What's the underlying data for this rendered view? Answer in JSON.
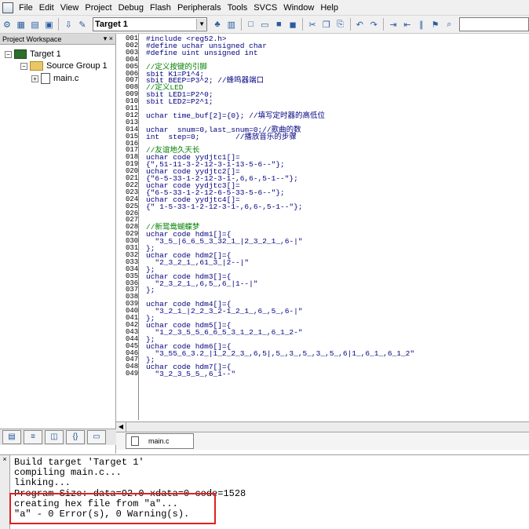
{
  "menubar": {
    "items": [
      "File",
      "Edit",
      "View",
      "Project",
      "Debug",
      "Flash",
      "Peripherals",
      "Tools",
      "SVCS",
      "Window",
      "Help"
    ]
  },
  "toolbar": {
    "target": "Target 1"
  },
  "workspace": {
    "title": "Project Workspace",
    "close": "▾ ×",
    "tree": {
      "target": "Target 1",
      "group": "Source Group 1",
      "file": "main.c"
    }
  },
  "editor": {
    "line_numbers": [
      "001",
      "002",
      "003",
      "004",
      "005",
      "006",
      "007",
      "008",
      "009",
      "010",
      "011",
      "012",
      "013",
      "014",
      "015",
      "016",
      "017",
      "018",
      "019",
      "020",
      "021",
      "022",
      "023",
      "024",
      "025",
      "026",
      "027",
      "028",
      "029",
      "030",
      "031",
      "032",
      "033",
      "034",
      "035",
      "036",
      "037",
      "038",
      "039",
      "040",
      "041",
      "042",
      "043",
      "044",
      "045",
      "046",
      "047",
      "048",
      "049"
    ],
    "lines": [
      "#include <reg52.h>",
      "#define uchar unsigned char",
      "#define uint unsigned int",
      "",
      "//定义按键的引脚",
      "sbit K1=P1^4;",
      "sbit BEEP=P3^2; //蜂鸣器端口",
      "//定义LED",
      "sbit LED1=P2^0;",
      "sbit LED2=P2^1;",
      "",
      "uchar time_buf[2]={0}; //填写定时器的高低位",
      "",
      "uchar  snum=0,last_snum=0;//歌曲的数",
      "int  step=0;        //播放音乐的步骤",
      "",
      "//友谊地久天长",
      "uchar code yydjtc1[]=",
      "{\",51-11-3-2-12-3-1-13-5-6--\"};",
      "uchar code yydjtc2[]=",
      "{\"6-5-33-1-2-12-3-1-,6,6-,5-1--\"};",
      "uchar code yydjtc3[]=",
      "{\"6-5-33-1-2-12-6-5-33-5-6--\"};",
      "uchar code yydjtc4[]=",
      "{\" 1-5-33-1-2-12-3-1-,6,6-,5-1--\"};",
      "",
      "",
      "//新鸳鸯蝴蝶梦",
      "uchar code hdm1[]={",
      "  \"3_5_|6_6_5_3_32_1_|2_3_2_1_,6-|\"",
      "};",
      "uchar code hdm2[]={",
      "  \"2_3_2_1_,61_3_|2--|\"",
      "};",
      "uchar code hdm3[]={",
      "  \"2_3_2_1_,6,5_,6_|1--|\"",
      "};",
      "",
      "uchar code hdm4[]={",
      "  \"3_2_1_|2_2_3_2-1_2_1_,6_,5_,6-|\"",
      "};",
      "uchar code hdm5[]={",
      "  \"1_2_3_5_5_6_6_5_3_1_2_1_,6_1_2-\"",
      "};",
      "uchar code hdm6[]={",
      "  \"3_55_6_3.2_|1_2_2_3_,6,5|,5_,3_,5_,3_,5_,6|1_,6_1_,6_1_2\"",
      "};",
      "uchar code hdm7[]={",
      "  \"3_2_3_5_5_,6_1--\""
    ]
  },
  "doc_tab": "main.c",
  "output": {
    "lines": [
      "Build target 'Target 1'",
      "compiling main.c...",
      "linking...",
      "Program Size: data=92.0 xdata=0 code=1528",
      "creating hex file from \"a\"...",
      "\"a\" - 0 Error(s), 0 Warning(s)."
    ]
  },
  "colors": {
    "code": "#000080",
    "comment": "#008000",
    "highlight": "#e02020"
  }
}
